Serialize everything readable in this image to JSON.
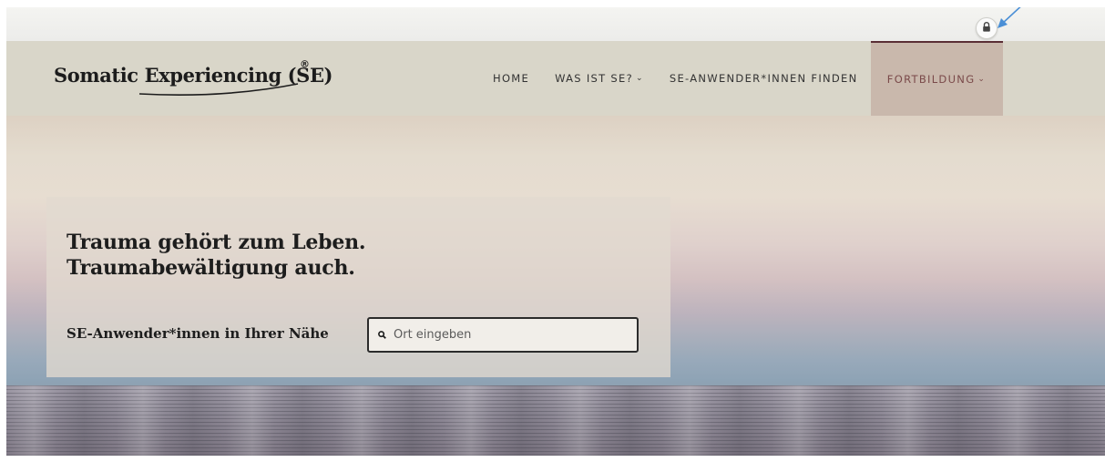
{
  "header": {
    "logo_text": "Somatic Experiencing (SE)",
    "logo_mark": "®"
  },
  "nav": {
    "items": [
      {
        "label": "HOME",
        "has_dropdown": false
      },
      {
        "label": "WAS IST SE?",
        "has_dropdown": true
      },
      {
        "label": "SE-ANWENDER*INNEN FINDEN",
        "has_dropdown": false
      },
      {
        "label": "FORTBILDUNG",
        "has_dropdown": true,
        "active": true
      }
    ],
    "dropdown_glyph": "⌄"
  },
  "utility": {
    "lock_icon": "lock-icon"
  },
  "hero": {
    "headline_line1": "Trauma gehört zum Leben.",
    "headline_line2": "Traumabewältigung auch.",
    "find_label": "SE-Anwender*innen in Ihrer Nähe",
    "search_placeholder": "Ort eingeben",
    "search_value": ""
  },
  "colors": {
    "nav_bg": "#d9d6c9",
    "active_tab_bg": "#c9b8ac",
    "active_tab_text": "#7a4a4a",
    "annotation_arrow": "#4a8fd6"
  }
}
